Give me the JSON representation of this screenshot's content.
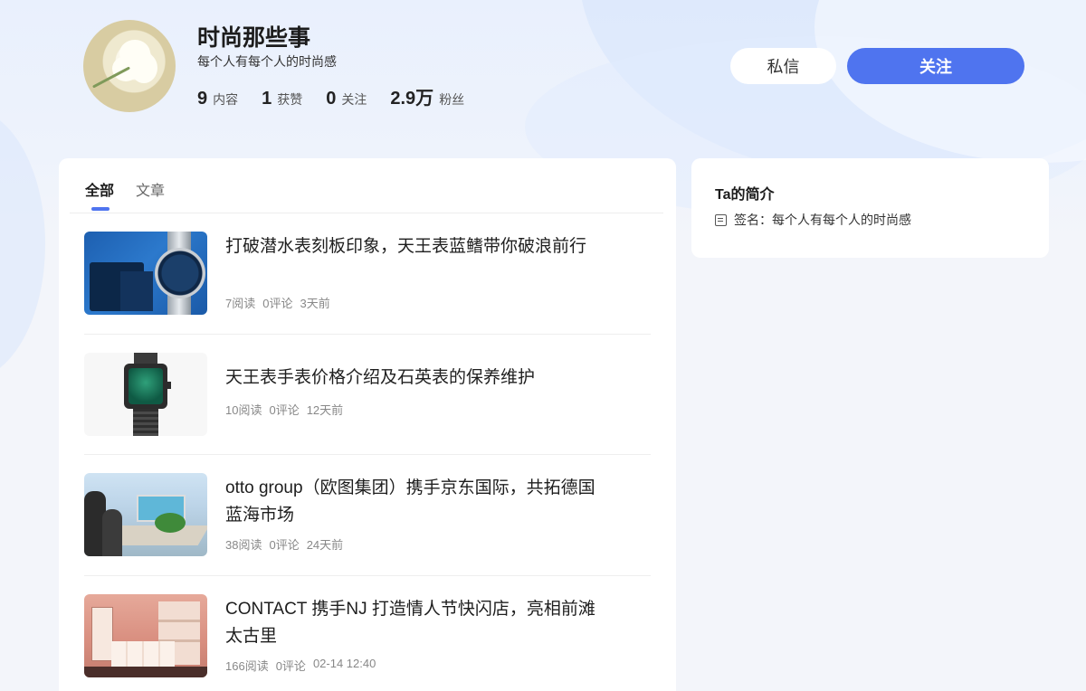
{
  "profile": {
    "name": "时尚那些事",
    "motto": "每个人有每个人的时尚感",
    "stats": [
      {
        "num": "9",
        "label": "内容"
      },
      {
        "num": "1",
        "label": "获赞"
      },
      {
        "num": "0",
        "label": "关注"
      },
      {
        "num": "2.9万",
        "label": "粉丝"
      }
    ]
  },
  "actions": {
    "message_label": "私信",
    "follow_label": "关注"
  },
  "tabs": [
    {
      "label": "全部",
      "active": true
    },
    {
      "label": "文章",
      "active": false
    }
  ],
  "articles": [
    {
      "title": "打破潜水表刻板印象，天王表蓝鳍带你破浪前行",
      "reads": "7阅读",
      "comments": "0评论",
      "time": "3天前"
    },
    {
      "title": "天王表手表价格介绍及石英表的保养维护",
      "reads": "10阅读",
      "comments": "0评论",
      "time": "12天前"
    },
    {
      "title": "otto group（欧图集团）携手京东国际，共拓德国蓝海市场",
      "reads": "38阅读",
      "comments": "0评论",
      "time": "24天前"
    },
    {
      "title": "CONTACT 携手NJ 打造情人节快闪店，亮相前滩太古里",
      "reads": "166阅读",
      "comments": "0评论",
      "time": "02-14 12:40"
    }
  ],
  "intro": {
    "title": "Ta的简介",
    "signature": "签名：每个人有每个人的时尚感"
  },
  "colors": {
    "accent": "#4f74ef",
    "page_bg": "#f3f5fa"
  }
}
